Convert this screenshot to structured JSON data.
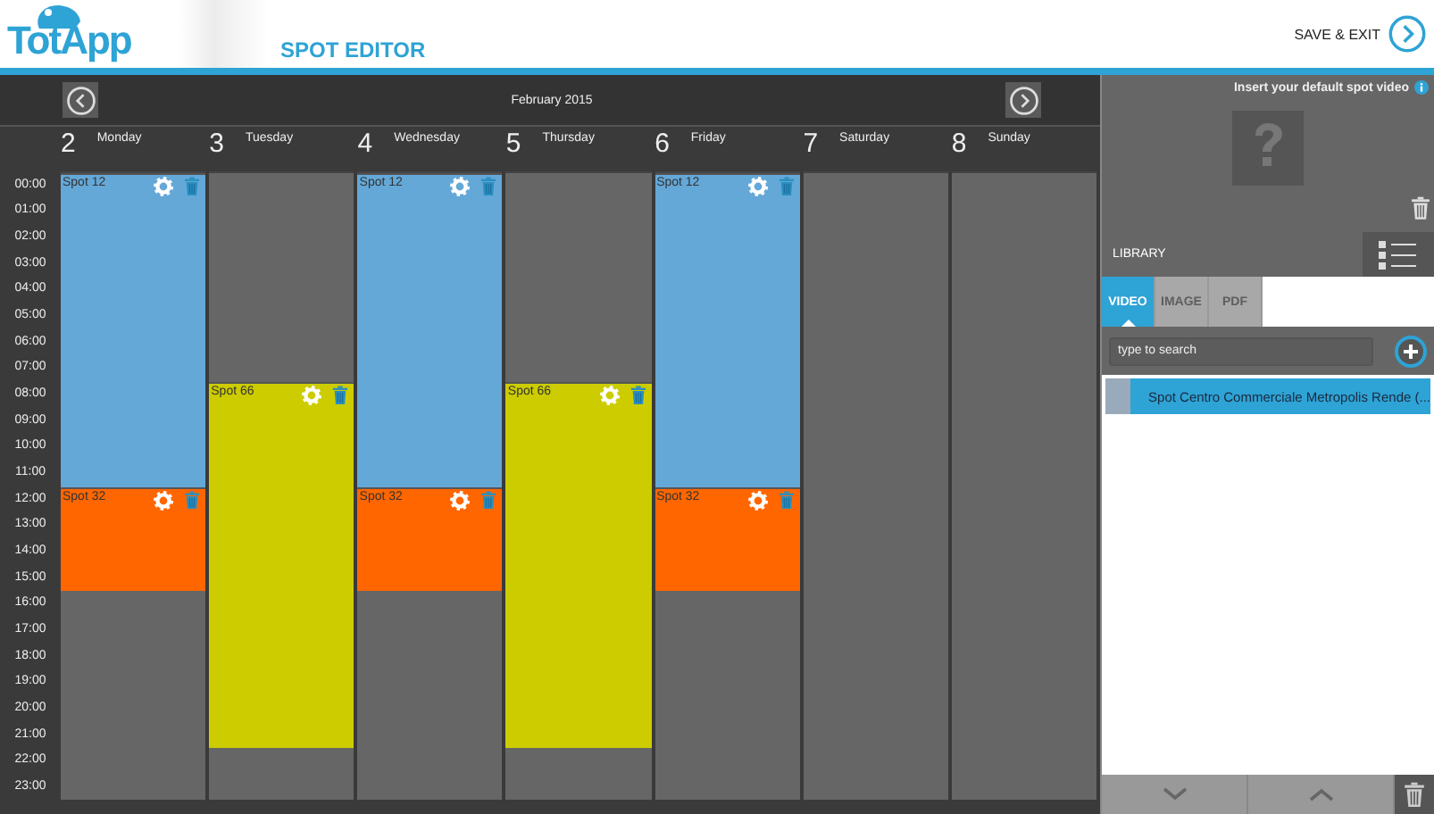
{
  "header": {
    "logo": "TotApp",
    "title": "SPOT EDITOR",
    "save_button": "SAVE & EXIT"
  },
  "calendar": {
    "month": "February 2015",
    "hours": [
      "00:00",
      "01:00",
      "02:00",
      "03:00",
      "04:00",
      "05:00",
      "06:00",
      "07:00",
      "08:00",
      "09:00",
      "10:00",
      "11:00",
      "12:00",
      "13:00",
      "14:00",
      "15:00",
      "16:00",
      "17:00",
      "18:00",
      "19:00",
      "20:00",
      "21:00",
      "22:00",
      "23:00"
    ],
    "days": [
      {
        "number": "2",
        "name": "Monday",
        "slots": [
          {
            "kind": "spot_start",
            "label": "Spot 12",
            "color": "#64a8d8"
          },
          {
            "kind": "spot_continue"
          },
          {
            "kind": "spot_continue"
          },
          {
            "kind": "spot_continue"
          },
          {
            "kind": "spot_continue"
          },
          {
            "kind": "spot_continue"
          },
          {
            "kind": "spot_continue"
          },
          {
            "kind": "spot_continue"
          },
          {
            "kind": "spot_continue"
          },
          {
            "kind": "spot_continue"
          },
          {
            "kind": "spot_continue"
          },
          {
            "kind": "spot_continue"
          },
          {
            "kind": "spot_start",
            "label": "Spot 32",
            "color": "#ff6600"
          },
          {
            "kind": "spot_continue"
          },
          {
            "kind": "spot_continue"
          },
          {
            "kind": "spot_continue"
          }
        ]
      },
      {
        "number": "3",
        "name": "Tuesday",
        "slots": [
          {
            "kind": "empty"
          },
          {
            "kind": "empty"
          },
          {
            "kind": "empty"
          },
          {
            "kind": "empty"
          },
          {
            "kind": "empty"
          },
          {
            "kind": "empty"
          },
          {
            "kind": "empty"
          },
          {
            "kind": "empty"
          },
          {
            "kind": "spot_start",
            "label": "Spot 66",
            "color": "#cccc00"
          },
          {
            "kind": "spot_continue"
          },
          {
            "kind": "spot_continue"
          },
          {
            "kind": "spot_continue"
          },
          {
            "kind": "spot_continue"
          },
          {
            "kind": "spot_continue"
          },
          {
            "kind": "spot_continue"
          },
          {
            "kind": "spot_continue"
          },
          {
            "kind": "spot_continue"
          },
          {
            "kind": "spot_continue"
          },
          {
            "kind": "spot_continue"
          },
          {
            "kind": "spot_continue"
          },
          {
            "kind": "spot_continue"
          },
          {
            "kind": "spot_continue"
          }
        ]
      },
      {
        "number": "4",
        "name": "Wednesday",
        "slots": [
          {
            "kind": "spot_start",
            "label": "Spot 12",
            "color": "#64a8d8"
          },
          {
            "kind": "spot_continue"
          },
          {
            "kind": "spot_continue"
          },
          {
            "kind": "spot_continue"
          },
          {
            "kind": "spot_continue"
          },
          {
            "kind": "spot_continue"
          },
          {
            "kind": "spot_continue"
          },
          {
            "kind": "spot_continue"
          },
          {
            "kind": "spot_continue"
          },
          {
            "kind": "spot_continue"
          },
          {
            "kind": "spot_continue"
          },
          {
            "kind": "spot_continue"
          },
          {
            "kind": "spot_start",
            "label": "Spot 32",
            "color": "#ff6600"
          },
          {
            "kind": "spot_continue"
          },
          {
            "kind": "spot_continue"
          },
          {
            "kind": "spot_continue"
          }
        ]
      },
      {
        "number": "5",
        "name": "Thursday",
        "slots": [
          {
            "kind": "empty"
          },
          {
            "kind": "empty"
          },
          {
            "kind": "empty"
          },
          {
            "kind": "empty"
          },
          {
            "kind": "empty"
          },
          {
            "kind": "empty"
          },
          {
            "kind": "empty"
          },
          {
            "kind": "empty"
          },
          {
            "kind": "spot_start",
            "label": "Spot 66",
            "color": "#cccc00"
          },
          {
            "kind": "spot_continue"
          },
          {
            "kind": "spot_continue"
          },
          {
            "kind": "spot_continue"
          },
          {
            "kind": "spot_continue"
          },
          {
            "kind": "spot_continue"
          },
          {
            "kind": "spot_continue"
          },
          {
            "kind": "spot_continue"
          },
          {
            "kind": "spot_continue"
          },
          {
            "kind": "spot_continue"
          },
          {
            "kind": "spot_continue"
          },
          {
            "kind": "spot_continue"
          },
          {
            "kind": "spot_continue"
          },
          {
            "kind": "spot_continue"
          }
        ]
      },
      {
        "number": "6",
        "name": "Friday",
        "slots": [
          {
            "kind": "spot_start",
            "label": "Spot 12",
            "color": "#64a8d8"
          },
          {
            "kind": "spot_continue"
          },
          {
            "kind": "spot_continue"
          },
          {
            "kind": "spot_continue"
          },
          {
            "kind": "spot_continue"
          },
          {
            "kind": "spot_continue"
          },
          {
            "kind": "spot_continue"
          },
          {
            "kind": "spot_continue"
          },
          {
            "kind": "spot_continue"
          },
          {
            "kind": "spot_continue"
          },
          {
            "kind": "spot_continue"
          },
          {
            "kind": "spot_continue"
          },
          {
            "kind": "spot_start",
            "label": "Spot 32",
            "color": "#ff6600"
          },
          {
            "kind": "spot_continue"
          },
          {
            "kind": "spot_continue"
          },
          {
            "kind": "spot_continue"
          }
        ]
      },
      {
        "number": "7",
        "name": "Saturday"
      },
      {
        "number": "8",
        "name": "Sunday"
      }
    ]
  },
  "panel": {
    "default_video": {
      "label": "Insert your default spot video"
    },
    "library": {
      "title": "LIBRARY",
      "tabs": [
        {
          "label": "VIDEO",
          "selected": true
        },
        {
          "label": "IMAGE",
          "selected": false
        },
        {
          "label": "PDF",
          "selected": false
        }
      ],
      "search": {
        "placeholder": "type to search"
      },
      "items": [
        {
          "title": "Spot Centro Commerciale Metropolis Rende (...",
          "selected": true
        }
      ]
    }
  }
}
